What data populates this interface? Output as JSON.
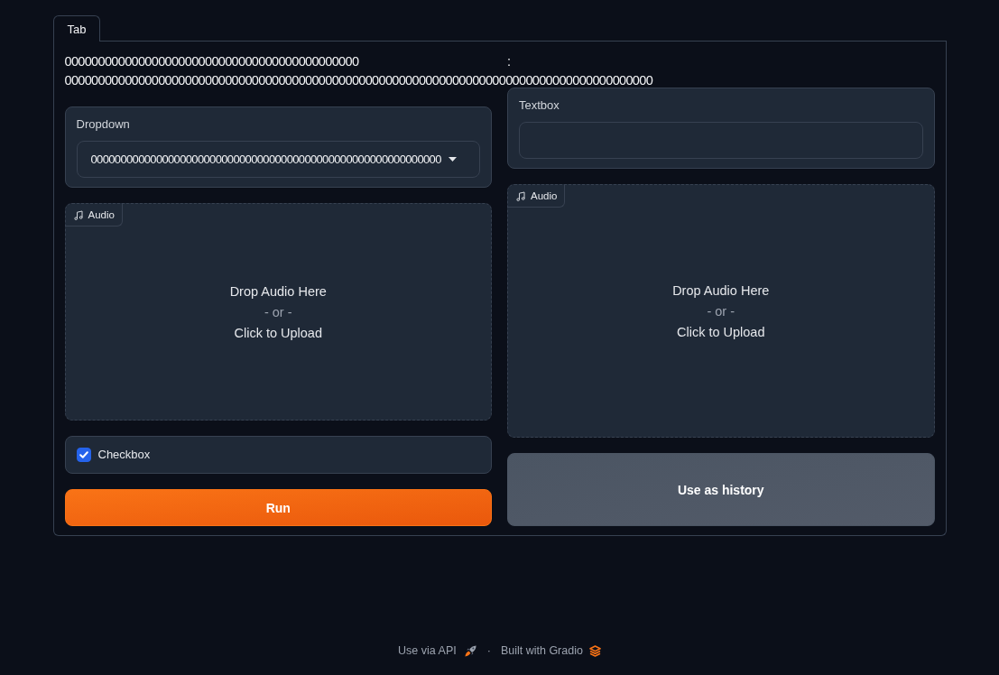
{
  "tabs": [
    {
      "label": "Tab",
      "selected": true
    }
  ],
  "columns": [
    {
      "components": [
        {
          "kind": "markdown",
          "lines": [
            "00000000000000000000000000000000000000000000",
            "0000000000000000000000000000000000000000000000000000000000000000000000000000000000000000"
          ]
        },
        {
          "kind": "dropdown",
          "label": "Dropdown",
          "value": "00000000000000000000000000000000000000000000000000000000000"
        },
        {
          "kind": "audio",
          "label": "Audio",
          "drop_text": "Drop Audio Here",
          "or_text": "- or -",
          "upload_text": "Click to Upload"
        },
        {
          "kind": "checkbox",
          "label": "Checkbox",
          "checked": true
        },
        {
          "kind": "primary",
          "label": "Run"
        }
      ]
    },
    {
      "components": [
        {
          "kind": "markdown",
          "lines": [
            ":"
          ]
        },
        {
          "kind": "textbox",
          "label": "Textbox"
        },
        {
          "kind": "audio",
          "label": "Audio",
          "drop_text": "Drop Audio Here",
          "or_text": "- or -",
          "upload_text": "Click to Upload"
        },
        {
          "kind": "secondary",
          "label": "Use as history"
        }
      ]
    }
  ],
  "footer": {
    "api_link": "Use via API",
    "separator": "·",
    "credit_link": "Built with Gradio"
  }
}
